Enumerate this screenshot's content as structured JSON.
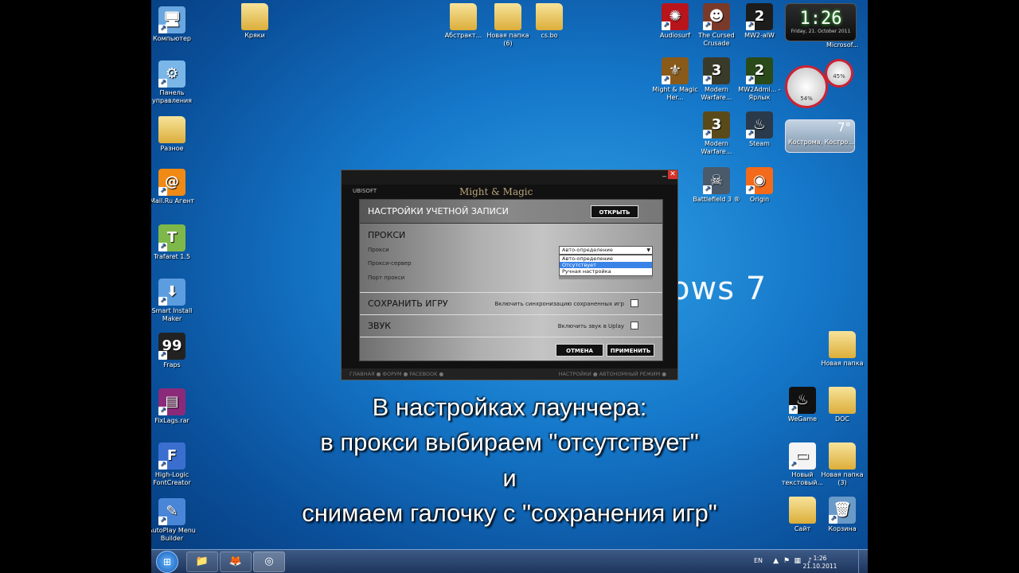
{
  "desktop_icons_left": [
    {
      "label": "Компьютер",
      "glyph": "🖥",
      "color": "#6aa7e0"
    },
    {
      "label": "Панель управления",
      "glyph": "⚙",
      "color": "#7ab6e8"
    },
    {
      "label": "Разное",
      "glyph": "",
      "folder": true
    },
    {
      "label": "Mail.Ru Агент",
      "glyph": "@",
      "color": "#f08a14"
    },
    {
      "label": "Trafaret 1.5",
      "glyph": "T",
      "color": "#7fb84a"
    },
    {
      "label": "Smart Install Maker",
      "glyph": "⬇",
      "color": "#5c9de0"
    },
    {
      "label": "Fraps",
      "glyph": "99",
      "color": "#222222"
    },
    {
      "label": "FixLags.rar",
      "glyph": "▤",
      "color": "#8c2a7a"
    },
    {
      "label": "High-Logic FontCreator",
      "glyph": "F",
      "color": "#3a6fd0"
    },
    {
      "label": "AutoPlay Menu Builder",
      "glyph": "✎",
      "color": "#4a86d8"
    }
  ],
  "desktop_icons_top": [
    {
      "label": "Кряки",
      "folder": true
    },
    {
      "label": "Абстракт...",
      "folder": true
    },
    {
      "label": "Новая папка (6)",
      "folder": true
    },
    {
      "label": "cs.bo",
      "folder": true
    }
  ],
  "desktop_icons_right": [
    {
      "label": "Audiosurf",
      "glyph": "✺",
      "color": "#b8141c"
    },
    {
      "label": "The Cursed Crusade",
      "glyph": "☻",
      "color": "#7a3a2a"
    },
    {
      "label": "MW2-alW",
      "glyph": "2",
      "color": "#1c1c1c"
    },
    {
      "label": "Might & Magic Her...",
      "glyph": "⚜",
      "color": "#8a5a1a"
    },
    {
      "label": "Modern Warfare...",
      "glyph": "3",
      "color": "#3a3a2a"
    },
    {
      "label": "MW2Admi... - Ярлык",
      "glyph": "2",
      "color": "#2a4a1a"
    },
    {
      "label": "Modern Warfare...",
      "glyph": "3",
      "color": "#5a4a1a"
    },
    {
      "label": "Steam",
      "glyph": "♨",
      "color": "#2a3a4a"
    },
    {
      "label": "Battlefield 3 ®",
      "glyph": "☠",
      "color": "#4a5a6a"
    },
    {
      "label": "Origin",
      "glyph": "◉",
      "color": "#f26a1a"
    }
  ],
  "desktop_icons_bottom_right": [
    {
      "label": "Новая папка",
      "folder": true
    },
    {
      "label": "WeGame",
      "glyph": "♨",
      "color": "#111111"
    },
    {
      "label": "DOC",
      "folder": true
    },
    {
      "label": "Новый текстовый...",
      "glyph": "▭",
      "color": "#f4f4f4"
    },
    {
      "label": "Новая папка (3)",
      "folder": true
    },
    {
      "label": "Сайт",
      "folder": true
    },
    {
      "label": "Корзина",
      "glyph": "🗑",
      "color": "#6a9ac8"
    }
  ],
  "gadgets": {
    "clock_time": "1:26",
    "clock_date": "Friday, 21. October 2011",
    "microsoft_label": "Microsof...",
    "cpu_percent": "54%",
    "mem_percent": "45%",
    "weather_temp": "7°",
    "weather_city": "Кострома, Костро..."
  },
  "wallpaper_text": "ows 7",
  "launcher": {
    "brand": "UBISOFT",
    "logo": "Might & Magic",
    "footer_left": "ГЛАВНАЯ ● ФОРУМ ● FACEBOOK ●",
    "footer_right": "НАСТРОЙКИ ● АВТОНОМНЫЙ РЕЖИМ ●",
    "close": "✕",
    "minimize": "_",
    "dialog": {
      "title": "НАСТРОЙКИ УЧЕТНОЙ ЗАПИСИ",
      "open_button": "ОТКРЫТЬ",
      "proxy_section": "ПРОКСИ",
      "proxy_label": "Прокси",
      "proxy_server_label": "Прокси-сервер",
      "proxy_port_label": "Порт прокси",
      "proxy_selected": "Авто-определение",
      "proxy_options": [
        "Авто-определение",
        "Отсутствует",
        "Ручная настройка"
      ],
      "save_section": "СОХРАНИТЬ ИГРУ",
      "save_option": "Включить синхронизацию сохраненных игр",
      "sound_section": "ЗВУК",
      "sound_option": "Включить звук в Uplay",
      "cancel_button": "ОТМЕНА",
      "apply_button": "ПРИМЕНИТЬ"
    }
  },
  "captions": [
    "В настройках лаунчера:",
    "в прокси выбираем \"отсутствует\"",
    "и",
    "снимаем галочку с \"сохранения игр\""
  ],
  "taskbar": {
    "start_glyph": "⊞",
    "pinned": [
      {
        "name": "explorer",
        "glyph": "📁"
      },
      {
        "name": "firefox",
        "glyph": "🦊"
      },
      {
        "name": "uplay",
        "glyph": "◎"
      }
    ],
    "lang": "EN",
    "time": "1:26",
    "date": "21.10.2011"
  }
}
